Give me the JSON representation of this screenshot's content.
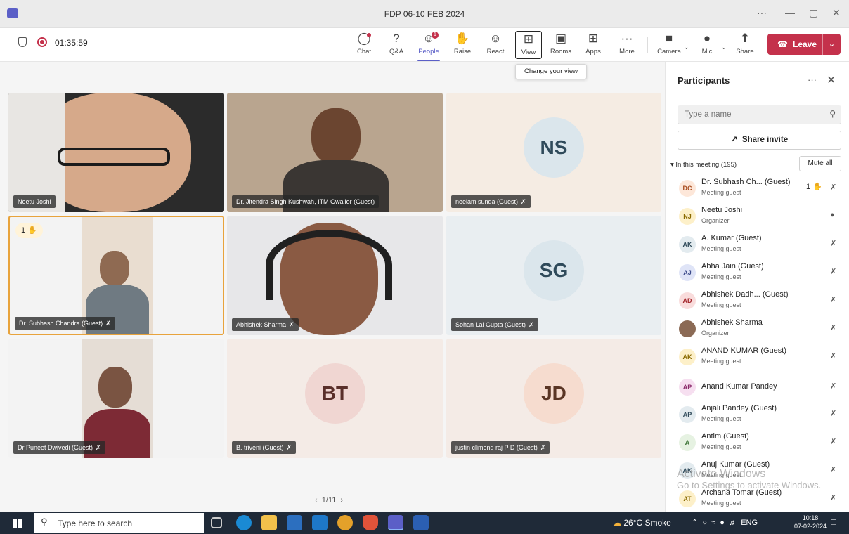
{
  "window": {
    "title": "FDP 06-10 FEB 2024"
  },
  "toolbar": {
    "timer": "01:35:59",
    "buttons": {
      "chat": "Chat",
      "qa": "Q&A",
      "people": "People",
      "raise": "Raise",
      "react": "React",
      "view": "View",
      "rooms": "Rooms",
      "apps": "Apps",
      "more": "More",
      "camera": "Camera",
      "mic": "Mic",
      "share": "Share"
    },
    "people_badge": "1",
    "leave": "Leave",
    "tooltip": "Change your view"
  },
  "stage": {
    "tiles": [
      {
        "name": "Neetu Joshi"
      },
      {
        "name": "Dr. Jitendra Singh Kushwah, ITM Gwalior (Guest)"
      },
      {
        "name": "neelam sunda (Guest)",
        "initials": "NS"
      },
      {
        "name": "Dr. Subhash Chandra (Guest)",
        "hand": "1"
      },
      {
        "name": "Abhishek Sharma"
      },
      {
        "name": "Sohan Lal Gupta (Guest)",
        "initials": "SG"
      },
      {
        "name": "Dr Puneet Dwivedi (Guest)"
      },
      {
        "name": "B. triveni (Guest)",
        "initials": "BT"
      },
      {
        "name": "justin climend raj P D (Guest)",
        "initials": "JD"
      }
    ],
    "pager": "1/11"
  },
  "panel": {
    "title": "Participants",
    "search_placeholder": "Type a name",
    "share_invite": "Share invite",
    "section": "In this meeting (195)",
    "mute_all": "Mute all",
    "participants": [
      {
        "initials": "DC",
        "name": "Dr. Subhash Ch... (Guest)",
        "role": "Meeting guest",
        "hand": "1"
      },
      {
        "initials": "NJ",
        "name": "Neetu Joshi",
        "role": "Organizer"
      },
      {
        "initials": "AK",
        "name": "A. Kumar (Guest)",
        "role": "Meeting guest"
      },
      {
        "initials": "AJ",
        "name": "Abha Jain (Guest)",
        "role": "Meeting guest"
      },
      {
        "initials": "AD",
        "name": "Abhishek Dadh... (Guest)",
        "role": "Meeting guest"
      },
      {
        "initials": "",
        "name": "Abhishek Sharma",
        "role": "Organizer"
      },
      {
        "initials": "AK",
        "name": "ANAND KUMAR (Guest)",
        "role": "Meeting guest"
      },
      {
        "initials": "AP",
        "name": "Anand Kumar Pandey",
        "role": ""
      },
      {
        "initials": "AP",
        "name": "Anjali Pandey (Guest)",
        "role": "Meeting guest"
      },
      {
        "initials": "A",
        "name": "Antim (Guest)",
        "role": "Meeting guest"
      },
      {
        "initials": "AK",
        "name": "Anuj Kumar (Guest)",
        "role": "Meeting guest"
      },
      {
        "initials": "AT",
        "name": "Archana Tomar (Guest)",
        "role": "Meeting guest"
      }
    ]
  },
  "watermark": {
    "line1": "Activate Windows",
    "line2": "Go to Settings to activate Windows."
  },
  "taskbar": {
    "search": "Type here to search",
    "weather": "26°C  Smoke",
    "lang": "ENG",
    "time": "10:18",
    "date": "07-02-2024"
  },
  "colors": {
    "accent": "#5b5fc7",
    "leave": "#c4314b",
    "active_tile": "#e8a33c"
  }
}
